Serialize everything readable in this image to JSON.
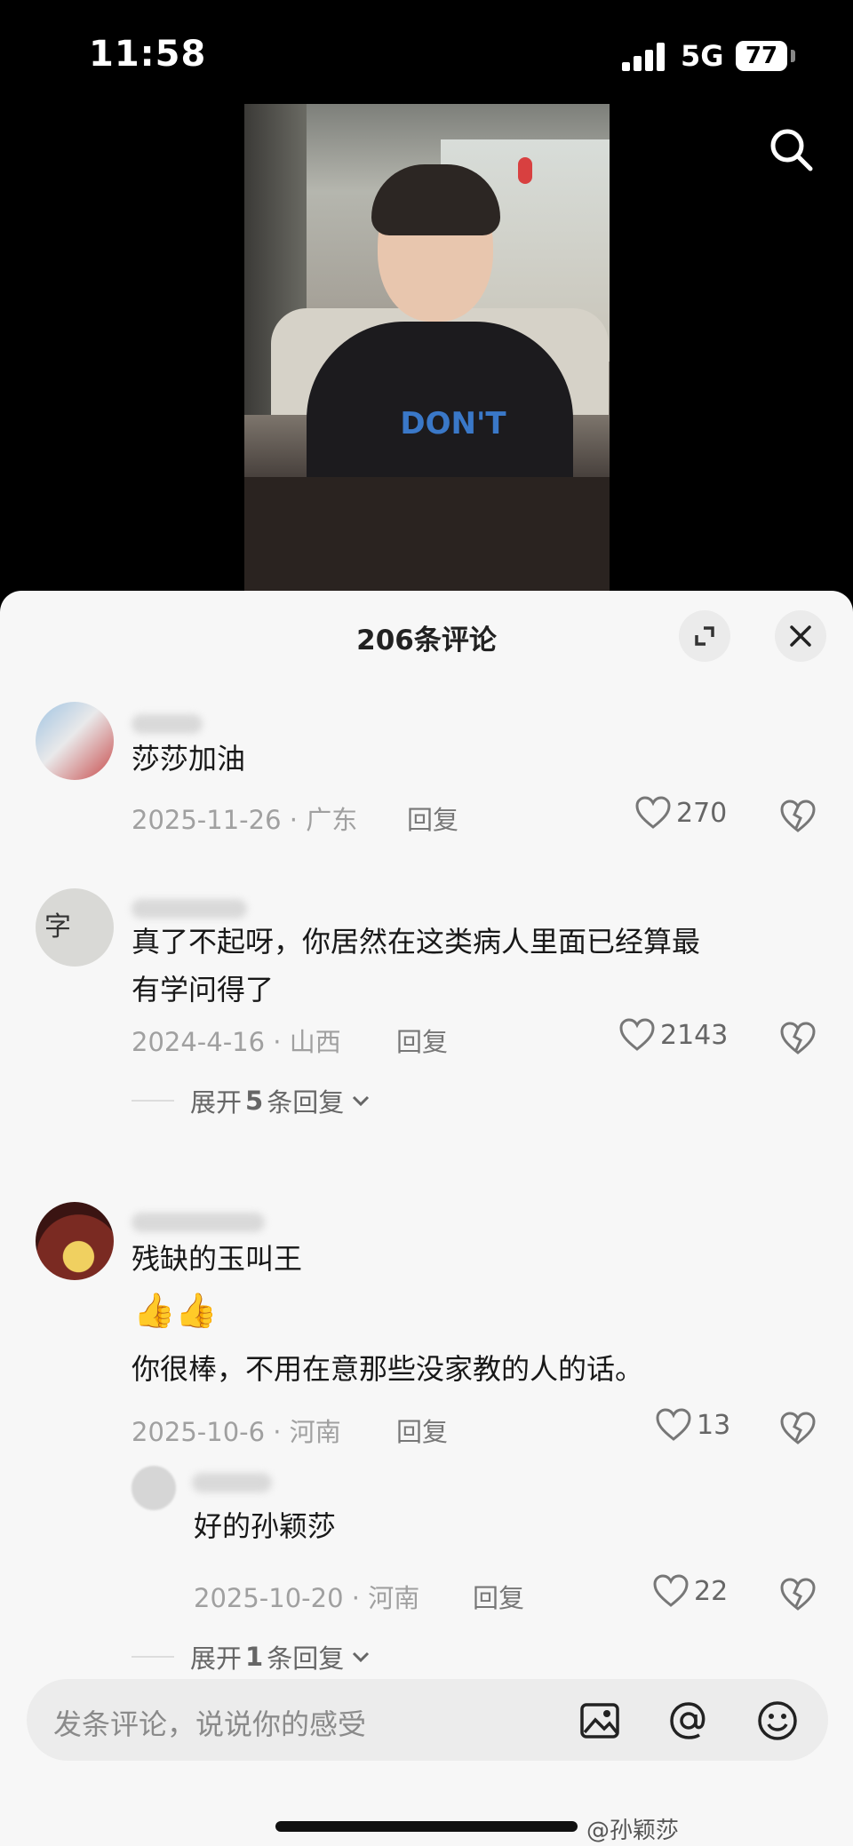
{
  "status_bar": {
    "time": "11:58",
    "network": "5G",
    "battery": "77"
  },
  "video": {
    "shirt_text": "DON'T"
  },
  "sheet": {
    "title": "206条评论"
  },
  "comments": [
    {
      "text": "莎莎加油",
      "meta": "2025-11-26 · 广东",
      "reply": "回复",
      "likes": "270"
    },
    {
      "text_line1": "真了不起呀，你居然在这类病人里面已经算最",
      "text_line2": "有学问得了",
      "meta": "2024-4-16 · 山西",
      "reply": "回复",
      "likes": "2143",
      "expand_prefix": "展开",
      "expand_count": "5",
      "expand_suffix": "条回复"
    },
    {
      "text_line1": "残缺的玉叫王",
      "emoji": "👍👍",
      "text_line3": "你很棒，不用在意那些没家教的人的话。",
      "meta": "2025-10-6 · 河南",
      "reply": "回复",
      "likes": "13"
    },
    {
      "text": "好的孙颖莎",
      "meta": "2025-10-20 · 河南",
      "reply": "回复",
      "likes": "22",
      "expand_prefix": "展开",
      "expand_count": "1",
      "expand_suffix": "条回复"
    }
  ],
  "input": {
    "placeholder": "发条评论，说说你的感受"
  },
  "watermark": "@孙颖莎"
}
